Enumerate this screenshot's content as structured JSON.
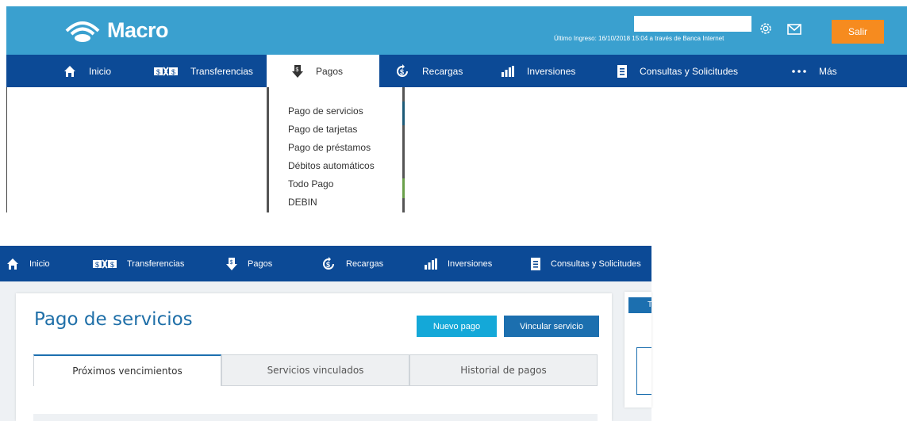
{
  "top": {
    "brand": "Macro",
    "last_login": "Último Ingreso: 16/10/2018 15:04 a través de Banca Internet",
    "icons": {
      "settings": "gear-icon",
      "messages": "envelope-icon"
    },
    "logout_label": "Salir",
    "nav": [
      {
        "label": "Inicio",
        "icon": "home-icon"
      },
      {
        "label": "Transferencias",
        "icon": "transfer-icon"
      },
      {
        "label": "Pagos",
        "icon": "payment-icon"
      },
      {
        "label": "Recargas",
        "icon": "recharge-icon"
      },
      {
        "label": "Inversiones",
        "icon": "bar-chart-icon"
      },
      {
        "label": "Consultas y Solicitudes",
        "icon": "document-icon"
      },
      {
        "label": "Más",
        "icon": "more-dots-icon"
      }
    ],
    "active_nav": "Pagos",
    "dropdown": [
      "Pago de servicios",
      "Pago de tarjetas",
      "Pago de préstamos",
      "Débitos automáticos",
      "Todo Pago",
      "DEBIN"
    ]
  },
  "bottom": {
    "nav": [
      {
        "label": "Inicio",
        "icon": "home-icon"
      },
      {
        "label": "Transferencias",
        "icon": "transfer-icon"
      },
      {
        "label": "Pagos",
        "icon": "payment-icon"
      },
      {
        "label": "Recargas",
        "icon": "recharge-icon"
      },
      {
        "label": "Inversiones",
        "icon": "bar-chart-icon"
      },
      {
        "label": "Consultas y Solicitudes",
        "icon": "document-icon"
      }
    ],
    "page_title": "Pago de servicios",
    "new_payment_label": "Nuevo pago",
    "link_service_label": "Vincular servicio",
    "tabs": [
      "Próximos vencimientos",
      "Servicios vinculados",
      "Historial de pagos"
    ],
    "active_tab": "Próximos vencimientos",
    "side_header_initial": "T"
  },
  "colors": {
    "topbar": "#3aa0cf",
    "navbar": "#0c4a96",
    "accent_orange": "#f68b1f",
    "title_blue": "#1f6fa8",
    "button_cyan": "#14a8d8",
    "button_blue": "#1c6faf"
  }
}
